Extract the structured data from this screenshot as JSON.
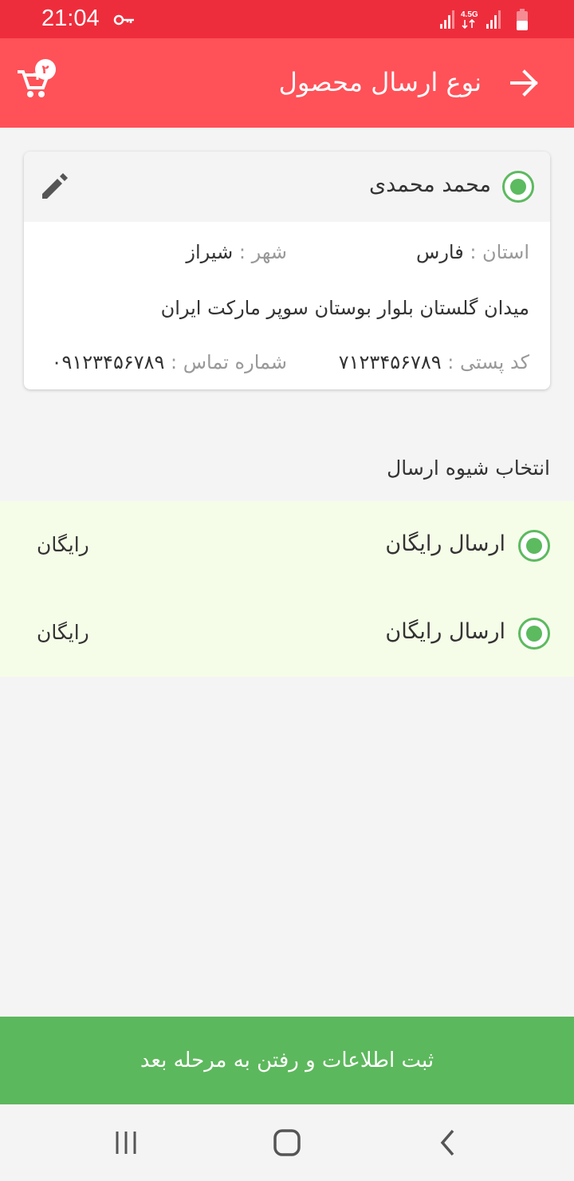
{
  "status_bar": {
    "time": "21:04",
    "network": "4.5G",
    "bg_color": "#ee2d3c",
    "icons": [
      "key-icon",
      "signal-icon",
      "data-arrows-icon",
      "signal-icon",
      "battery-icon"
    ]
  },
  "app_bar": {
    "title": "نوع ارسال محصول",
    "back_icon": "arrow-right-icon",
    "cart_icon": "cart-icon",
    "cart_count": "۲",
    "bg_color": "#ff5158"
  },
  "address": {
    "name": "محمد محمدی",
    "province_label": "استان :",
    "province": "فارس",
    "city_label": "شهر :",
    "city": "شیراز",
    "street": "میدان گلستان بلوار بوستان سوپر مارکت ایران",
    "postal_label": "کد پستی :",
    "postal_code": "۷۱۲۳۴۵۶۷۸۹",
    "phone_label": "شماره تماس :",
    "phone": "۰۹۱۲۳۴۵۶۷۸۹",
    "edit_icon": "pencil-icon",
    "selected": true
  },
  "shipping": {
    "section_title": "انتخاب شیوه ارسال",
    "options": [
      {
        "name": "ارسال رایگان",
        "price": "رایگان",
        "selected": true
      },
      {
        "name": "ارسال رایگان",
        "price": "رایگان",
        "selected": true
      }
    ],
    "panel_color": "#f5fde8",
    "radio_color": "#5cba5f"
  },
  "footer": {
    "submit_label": "ثبت اطلاعات و رفتن به مرحله بعد",
    "button_color": "#5cb85c"
  },
  "nav_bar": {
    "icons": [
      "recent-apps-icon",
      "home-icon",
      "back-icon"
    ]
  }
}
